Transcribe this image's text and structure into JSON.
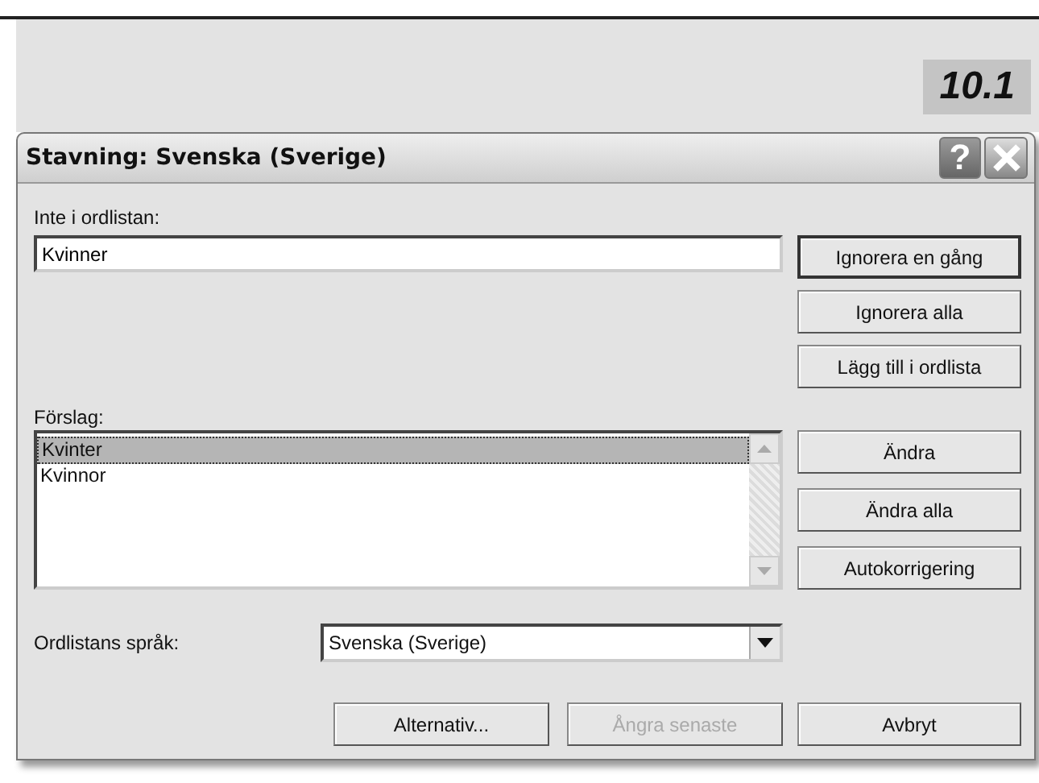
{
  "figure_label": "10.1",
  "window": {
    "title": "Stavning: Svenska (Sverige)",
    "help_button": "?"
  },
  "not_in_dictionary": {
    "label": "Inte i ordlistan:",
    "value": "Kvinner"
  },
  "ignore_buttons": [
    {
      "label": "Ignorera en gång",
      "default": true
    },
    {
      "label": "Ignorera alla",
      "default": false
    },
    {
      "label": "Lägg till i ordlista",
      "default": false
    }
  ],
  "suggestions": {
    "label": "Förslag:",
    "items": [
      {
        "text": "Kvinter",
        "selected": true
      },
      {
        "text": "Kvinnor",
        "selected": false
      }
    ]
  },
  "change_buttons": [
    {
      "label": "Ändra",
      "default": false
    },
    {
      "label": "Ändra alla",
      "default": false
    },
    {
      "label": "Autokorrigering",
      "default": false
    }
  ],
  "language": {
    "label": "Ordlistans språk:",
    "value": "Svenska (Sverige)"
  },
  "bottom_buttons": [
    {
      "label": "Alternativ...",
      "disabled": false
    },
    {
      "label": "Ångra senaste",
      "disabled": true
    },
    {
      "label": "Avbryt",
      "disabled": false
    }
  ]
}
